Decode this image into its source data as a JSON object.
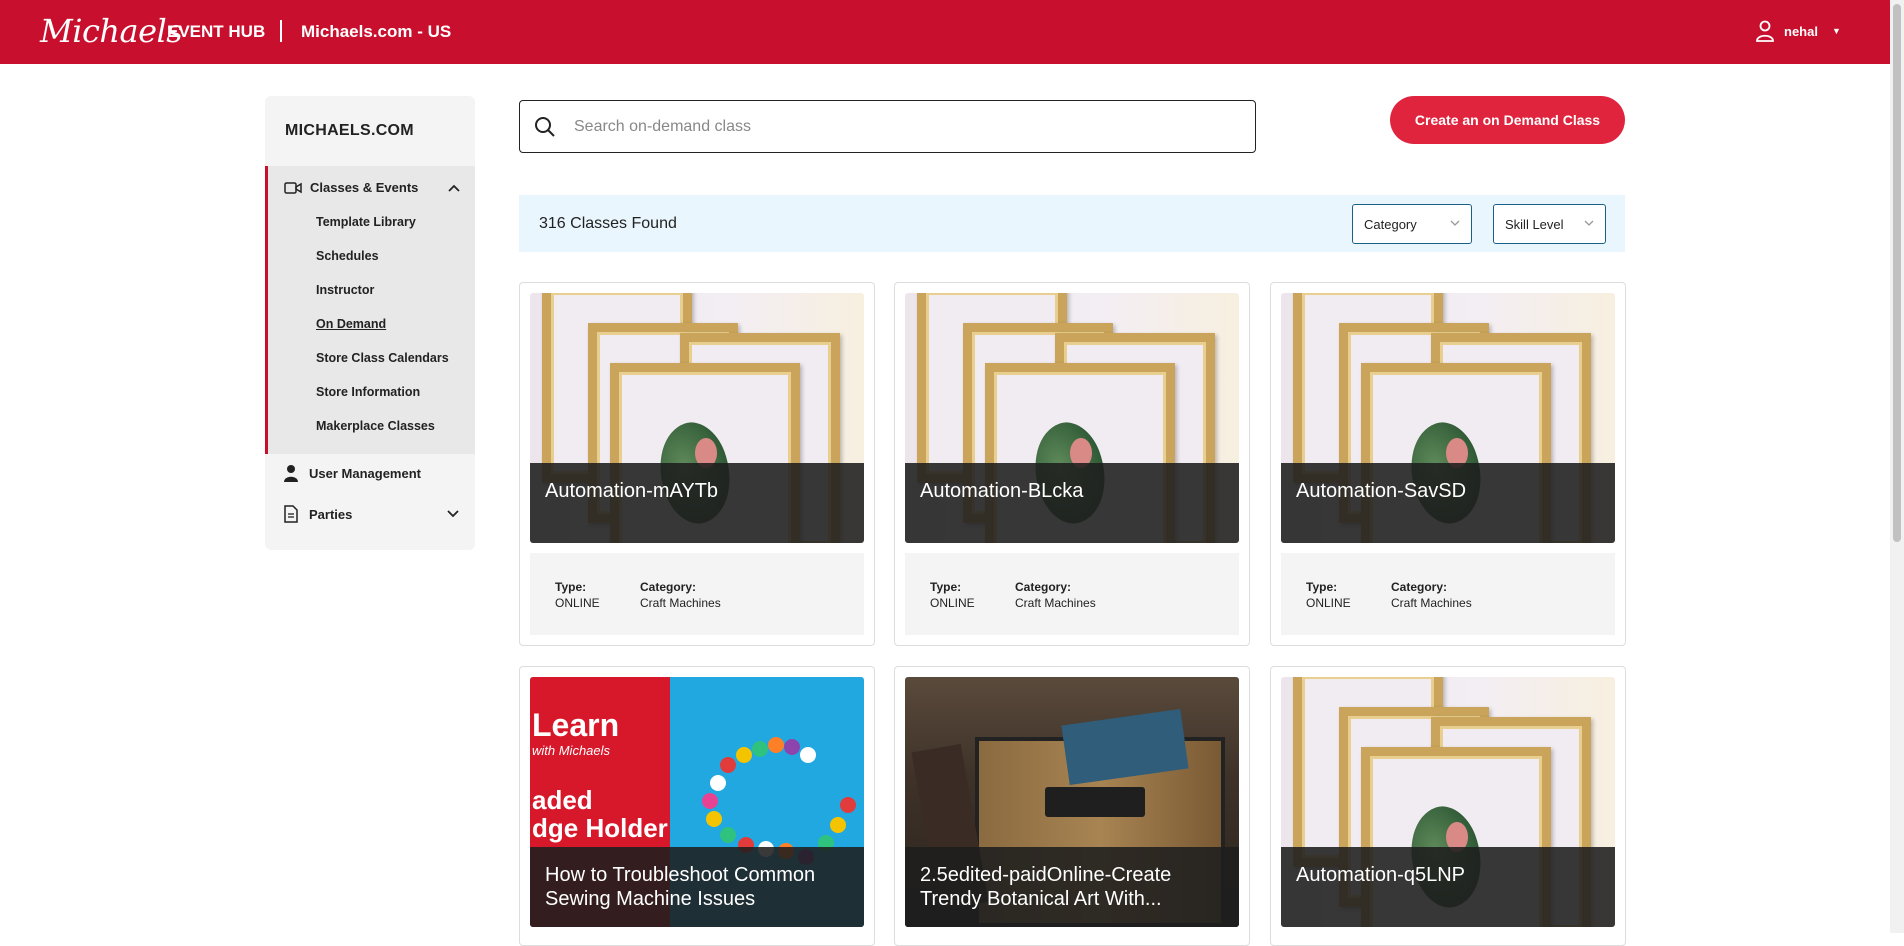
{
  "header": {
    "logo": "Michaels",
    "hub": "EVENT HUB",
    "site": "Michaels.com - US",
    "user": "nehal"
  },
  "sidebar": {
    "title": "MICHAELS.COM",
    "section": "Classes & Events",
    "items": [
      {
        "label": "Template Library"
      },
      {
        "label": "Schedules"
      },
      {
        "label": "Instructor"
      },
      {
        "label": "On Demand"
      },
      {
        "label": "Store Class Calendars"
      },
      {
        "label": "Store Information"
      },
      {
        "label": "Makerplace Classes"
      }
    ],
    "user_management": "User Management",
    "parties": "Parties"
  },
  "search": {
    "placeholder": "Search on-demand class"
  },
  "create_button": "Create an on Demand Class",
  "results": {
    "count": "316 Classes Found",
    "category": "Category",
    "skill": "Skill Level"
  },
  "labels": {
    "type": "Type:",
    "category": "Category:"
  },
  "cards": [
    {
      "title": "Automation-mAYTb",
      "type": "ONLINE",
      "category": "Craft Machines"
    },
    {
      "title": "Automation-BLcka",
      "type": "ONLINE",
      "category": "Craft Machines"
    },
    {
      "title": "Automation-SavSD",
      "type": "ONLINE",
      "category": "Craft Machines"
    },
    {
      "title": "How to Troubleshoot Common Sewing Machine Issues"
    },
    {
      "title": "2.5edited-paidOnline-Create Trendy Botanical Art With..."
    },
    {
      "title": "Automation-q5LNP"
    }
  ],
  "art_text": {
    "learn": "Learn",
    "with": "with Michaels",
    "line1": "aded",
    "line2": "dge Holder"
  },
  "colors": {
    "brand": "#c8102e",
    "cta": "#e0243e",
    "results_bg": "#eaf6fd"
  }
}
